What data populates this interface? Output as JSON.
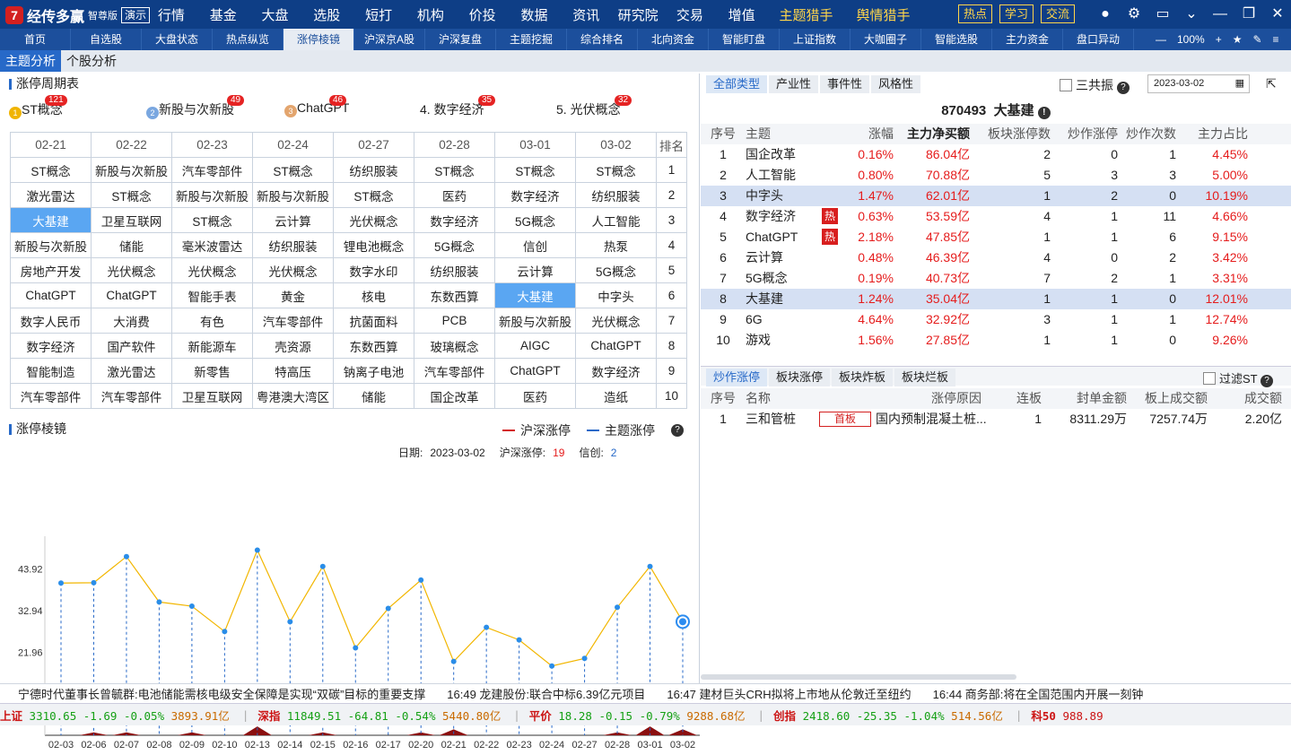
{
  "app": {
    "name": "经传多赢",
    "edition": "智尊版",
    "demo": "演示"
  },
  "top_menu": [
    "行情",
    "基金",
    "大盘",
    "选股",
    "短打",
    "机构",
    "价投",
    "数据",
    "资讯",
    "研究院",
    "交易",
    "增值"
  ],
  "top_menu_hl": [
    "主题猎手",
    "舆情猎手"
  ],
  "top_right": [
    "热点",
    "学习",
    "交流"
  ],
  "tabs": [
    "首页",
    "自选股",
    "大盘状态",
    "热点纵览",
    "涨停棱镜",
    "沪深京A股",
    "沪深复盘",
    "主题挖掘",
    "综合排名",
    "北向资金",
    "智能盯盘",
    "上证指数",
    "大咖圈子",
    "智能选股",
    "主力资金",
    "盘口异动"
  ],
  "tab_active": "涨停棱镜",
  "zoom": "100%",
  "subtabs": [
    "主题分析",
    "个股分析"
  ],
  "cycle": {
    "title": "涨停周期表",
    "top5": [
      {
        "n": "1",
        "name": "ST概念",
        "cnt": "121",
        "c": "#f0b400"
      },
      {
        "n": "2",
        "name": "新股与次新股",
        "cnt": "49",
        "c": "#7aa7e0"
      },
      {
        "n": "3",
        "name": "ChatGPT",
        "cnt": "46",
        "c": "#e3a56e"
      },
      {
        "n": "",
        "name": "4. 数字经济",
        "cnt": "35",
        "c": ""
      },
      {
        "n": "",
        "name": "5. 光伏概念",
        "cnt": "32",
        "c": ""
      }
    ],
    "dates": [
      "02-21",
      "02-22",
      "02-23",
      "02-24",
      "02-27",
      "02-28",
      "03-01",
      "03-02"
    ],
    "rank_label": "排名",
    "rows": [
      [
        "ST概念",
        "新股与次新股",
        "汽车零部件",
        "ST概念",
        "纺织服装",
        "ST概念",
        "ST概念",
        "ST概念",
        "1"
      ],
      [
        "激光雷达",
        "ST概念",
        "新股与次新股",
        "新股与次新股",
        "ST概念",
        "医药",
        "数字经济",
        "纺织服装",
        "2"
      ],
      [
        "大基建",
        "卫星互联网",
        "ST概念",
        "云计算",
        "光伏概念",
        "数字经济",
        "5G概念",
        "人工智能",
        "3"
      ],
      [
        "新股与次新股",
        "储能",
        "毫米波雷达",
        "纺织服装",
        "锂电池概念",
        "5G概念",
        "信创",
        "热泵",
        "4"
      ],
      [
        "房地产开发",
        "光伏概念",
        "光伏概念",
        "光伏概念",
        "数字水印",
        "纺织服装",
        "云计算",
        "5G概念",
        "5"
      ],
      [
        "ChatGPT",
        "ChatGPT",
        "智能手表",
        "黄金",
        "核电",
        "东数西算",
        "大基建",
        "中字头",
        "6"
      ],
      [
        "数字人民币",
        "大消费",
        "有色",
        "汽车零部件",
        "抗菌面料",
        "PCB",
        "新股与次新股",
        "光伏概念",
        "7"
      ],
      [
        "数字经济",
        "国产软件",
        "新能源车",
        "壳资源",
        "东数西算",
        "玻璃概念",
        "AIGC",
        "ChatGPT",
        "8"
      ],
      [
        "智能制造",
        "激光雷达",
        "新零售",
        "特高压",
        "钠离子电池",
        "汽车零部件",
        "ChatGPT",
        "数字经济",
        "9"
      ],
      [
        "汽车零部件",
        "汽车零部件",
        "卫星互联网",
        "粤港澳大湾区",
        "储能",
        "国企改革",
        "医药",
        "造纸",
        "10"
      ]
    ]
  },
  "prism": {
    "title": "涨停棱镜",
    "legend": [
      "沪深涨停",
      "主题涨停"
    ],
    "date_label": "日期:",
    "date": "2023-03-02",
    "hs_label": "沪深涨停:",
    "hs": "19",
    "theme_label": "信创:",
    "theme": "2"
  },
  "chart_data": {
    "type": "line",
    "x": [
      "02-03",
      "02-06",
      "02-07",
      "02-08",
      "02-09",
      "02-10",
      "02-13",
      "02-14",
      "02-15",
      "02-16",
      "02-17",
      "02-20",
      "02-21",
      "02-22",
      "02-23",
      "02-24",
      "02-27",
      "02-28",
      "03-01",
      "03-02"
    ],
    "series": [
      {
        "name": "沪深涨停",
        "values": [
          40.2,
          40.3,
          47.2,
          35.2,
          34.1,
          27.4,
          48.9,
          30.0,
          44.6,
          23.1,
          33.5,
          41.0,
          19.5,
          28.5,
          25.2,
          18.3,
          20.3,
          33.8,
          44.6,
          30.0
        ]
      },
      {
        "name": "主题涨停",
        "values": [
          0,
          1,
          1,
          0,
          1,
          0,
          3,
          0,
          1,
          0,
          0,
          1,
          2,
          0,
          0,
          0,
          0,
          1,
          3,
          2
        ]
      }
    ],
    "yticks": [
      10.98,
      21.96,
      32.94,
      43.92
    ],
    "ylim": [
      0,
      54
    ]
  },
  "right": {
    "type_tabs": [
      "全部类型",
      "产业性",
      "事件性",
      "风格性"
    ],
    "sgz": "三共振",
    "date": "2023-03-02",
    "block_code": "870493",
    "block_name": "大基建",
    "headers": [
      "序号",
      "主题",
      "涨幅",
      "主力净买额",
      "板块涨停数",
      "炒作涨停",
      "炒作次数",
      "主力占比"
    ],
    "rows": [
      {
        "i": "1",
        "n": "国企改革",
        "hot": "",
        "z": "0.16%",
        "m": "86.04亿",
        "b": "2",
        "c": "0",
        "t": "1",
        "p": "4.45%"
      },
      {
        "i": "2",
        "n": "人工智能",
        "hot": "",
        "z": "0.80%",
        "m": "70.88亿",
        "b": "5",
        "c": "3",
        "t": "3",
        "p": "5.00%"
      },
      {
        "i": "3",
        "n": "中字头",
        "hot": "",
        "z": "1.47%",
        "m": "62.01亿",
        "b": "1",
        "c": "2",
        "t": "0",
        "p": "10.19%"
      },
      {
        "i": "4",
        "n": "数字经济",
        "hot": "热",
        "z": "0.63%",
        "m": "53.59亿",
        "b": "4",
        "c": "1",
        "t": "11",
        "p": "4.66%"
      },
      {
        "i": "5",
        "n": "ChatGPT",
        "hot": "热",
        "z": "2.18%",
        "m": "47.85亿",
        "b": "1",
        "c": "1",
        "t": "6",
        "p": "9.15%"
      },
      {
        "i": "6",
        "n": "云计算",
        "hot": "",
        "z": "0.48%",
        "m": "46.39亿",
        "b": "4",
        "c": "0",
        "t": "2",
        "p": "3.42%"
      },
      {
        "i": "7",
        "n": "5G概念",
        "hot": "",
        "z": "0.19%",
        "m": "40.73亿",
        "b": "7",
        "c": "2",
        "t": "1",
        "p": "3.31%"
      },
      {
        "i": "8",
        "n": "大基建",
        "hot": "",
        "z": "1.24%",
        "m": "35.04亿",
        "b": "1",
        "c": "1",
        "t": "0",
        "p": "12.01%"
      },
      {
        "i": "9",
        "n": "6G",
        "hot": "",
        "z": "4.64%",
        "m": "32.92亿",
        "b": "3",
        "c": "1",
        "t": "1",
        "p": "12.74%"
      },
      {
        "i": "10",
        "n": "游戏",
        "hot": "",
        "z": "1.56%",
        "m": "27.85亿",
        "b": "1",
        "c": "1",
        "t": "0",
        "p": "9.26%"
      }
    ],
    "stock_tabs": [
      "炒作涨停",
      "板块涨停",
      "板块炸板",
      "板块烂板"
    ],
    "filter": "过滤ST",
    "stock_headers": [
      "序号",
      "名称",
      "涨停原因",
      "连板",
      "封单金额",
      "板上成交额",
      "成交额"
    ],
    "stocks": [
      {
        "i": "1",
        "n": "三和管桩",
        "tag": "首板",
        "reason": "国内预制混凝土桩...",
        "lb": "1",
        "fd": "8311.29万",
        "bs": "7257.74万",
        "cj": "2.20亿"
      }
    ]
  },
  "ticker": [
    "宁德时代董事长曾毓群:电池储能需核电级安全保障是实现“双碳”目标的重要支撑",
    "16:49 龙建股份:联合中标6.39亿元项目",
    "16:47 建材巨头CRH拟将上市地从伦敦迁至纽约",
    "16:44 商务部:将在全国范围内开展一刻钟"
  ],
  "indices": [
    {
      "name": "上证",
      "p": "3310.65",
      "c": "-1.69",
      "pct": "-0.05%",
      "amt": "3893.91亿"
    },
    {
      "name": "深指",
      "p": "11849.51",
      "c": "-64.81",
      "pct": "-0.54%",
      "amt": "5440.80亿"
    },
    {
      "name": "平价",
      "p": "18.28",
      "c": "-0.15",
      "pct": "-0.79%",
      "amt": "9288.68亿"
    },
    {
      "name": "创指",
      "p": "2418.60",
      "c": "-25.35",
      "pct": "-1.04%",
      "amt": "514.56亿"
    },
    {
      "name": "科50",
      "p": "988.89",
      "c": "",
      "pct": "",
      "amt": ""
    }
  ]
}
